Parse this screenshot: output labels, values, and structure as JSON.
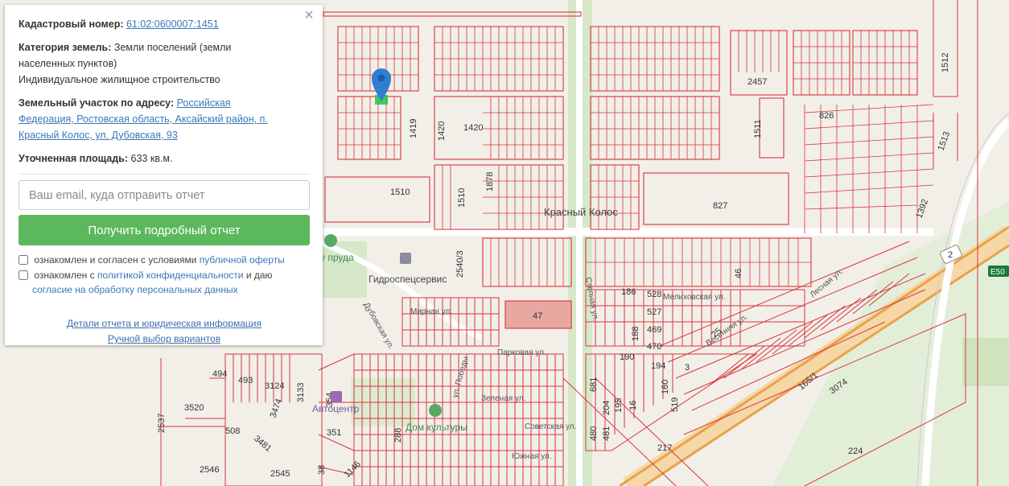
{
  "panel": {
    "cadastral_label": "Кадастровый номер:",
    "cadastral_value": "61:02:0600007:1451",
    "category_label": "Категория земель:",
    "category_value_1": "Земли поселений (земли",
    "category_value_2": "населенных пунктов)",
    "category_value_3": "Индивидуальное жилищное строительство",
    "address_label": "Земельный участок по адресу:",
    "address_value_1": "Российская",
    "address_value_2": "Федерация, Ростовская область, Аксайский район, п.",
    "address_value_3": "Красный Колос, ул. Дубовская, 93",
    "area_label": "Уточненная площадь:",
    "area_value": "633 кв.м.",
    "email_placeholder": "Ваш email, куда отправить отчет",
    "cta_label": "Получить подробный отчет",
    "consent1_text": "ознакомлен и согласен с условиями",
    "consent1_link": "публичной оферты",
    "consent2_text_a": "ознакомлен с",
    "consent2_link_a": "политикой конфиденциальности",
    "consent2_text_b": "и даю",
    "consent2_link_b": "согласие на обработку персональных данных",
    "details_link": "Детали отчета и юридическая информация",
    "manual_link": "Ручной выбор вариантов",
    "close_symbol": "×"
  },
  "map": {
    "place": "Красный Колос",
    "pond_poi": "у пруда",
    "gidro_poi": "Гидроспецсервис",
    "avto_poi": "Автоцентр",
    "culture_poi": "Дом культуры",
    "road_shield": "2",
    "road_badge": "Е50",
    "streets": {
      "melikhovskaya": "Мелиховская ул.",
      "parkovaya": "Парковая ул.",
      "sovetskaya": "Советская ул.",
      "pobedy": "ул. Победы",
      "mirnaya": "Мирная ул.",
      "yuzhnaya": "Южная ул.",
      "dubovskaya": "Дубовская ул.",
      "zelenaya": "Зеленая ул.",
      "vesennyaya": "Весенняя ул.",
      "lesnaya": "Лесная ул.",
      "stepnaya": "Степная ул."
    },
    "parcels": {
      "p1419": "1419",
      "p1420a": "1420",
      "p1420b": "1420",
      "p1510a": "1510",
      "p1510b": "1510",
      "p1878": "1878",
      "p2457": "2457",
      "p1511": "1511",
      "p826": "826",
      "p1512": "1512",
      "p1513": "1513",
      "p827": "827",
      "p1392": "1392",
      "p2540": "2540/3",
      "p47": "47",
      "p186": "186",
      "p528": "528",
      "p527": "527",
      "p469": "469",
      "p470": "470",
      "p188": "188",
      "p190": "190",
      "p194": "194",
      "p681": "681",
      "p160": "160",
      "p519": "519",
      "p204": "204",
      "p195": "195",
      "p16": "16",
      "p480": "480",
      "p481": "481",
      "p217": "217",
      "p224": "224",
      "p165": "165/1",
      "p3074": "3074",
      "p494": "494",
      "p493": "493",
      "p3124": "3124",
      "p3133": "3133",
      "p3520": "3520",
      "p3474": "3474",
      "p508": "508",
      "p3481": "3481",
      "p354": "354",
      "p351": "351",
      "p288": "288",
      "p2537": "2537",
      "p2546": "2546",
      "p2545": "2545",
      "p38": "38",
      "p1146": "1146",
      "p46": "46",
      "p25": "25",
      "p3": "3"
    }
  }
}
